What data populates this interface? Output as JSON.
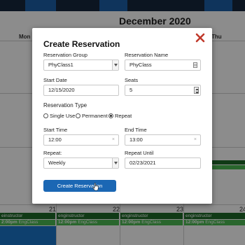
{
  "calendar": {
    "month_title": "December 2020",
    "weekdays": {
      "mon": "Mon",
      "thu": "Thu"
    },
    "days": [
      {
        "num": "21"
      },
      {
        "num": "22"
      },
      {
        "num": "23"
      },
      {
        "num": "24"
      }
    ],
    "events": [
      {
        "instructor": "einstructor",
        "time": "2:00pm",
        "class": "EngClass"
      },
      {
        "instructor": "enginstructor",
        "time": "12:00pm",
        "class": "EngClass"
      },
      {
        "instructor": "enginstructor",
        "time": "12:00pm",
        "class": "EngClass"
      },
      {
        "instructor": "enginstructor",
        "time": "12:00pm",
        "class": "EngClass"
      }
    ],
    "colors": {
      "event_dark": "#1e6b28",
      "event_light": "#4cba52",
      "selected_cell": "#1b76c9",
      "header_bar": "#16273d"
    }
  },
  "modal": {
    "title": "Create Reservation",
    "close_icon": "close-x-icon",
    "reservation_group": {
      "label": "Reservation Group",
      "value": "PhyClass1"
    },
    "reservation_name": {
      "label": "Reservation Name",
      "value": "PhyClass"
    },
    "start_date": {
      "label": "Start Date",
      "value": "12/15/2020"
    },
    "seats": {
      "label": "Seats",
      "value": "5"
    },
    "reservation_type": {
      "label": "Reservation Type",
      "options": [
        "Single Use",
        "Permanent",
        "Repeat"
      ],
      "selected": "Repeat"
    },
    "start_time": {
      "label": "Start Time",
      "value": "12:00",
      "clear": "×"
    },
    "end_time": {
      "label": "End Time",
      "value": "13:00",
      "clear": "×"
    },
    "repeat": {
      "label": "Repeat:",
      "value": "Weekly"
    },
    "repeat_until": {
      "label": "Repeat Until",
      "value": "02/23/2021"
    },
    "submit_label": "Create Reservation",
    "accent_color": "#1b67b4",
    "close_color": "#c0392b"
  }
}
